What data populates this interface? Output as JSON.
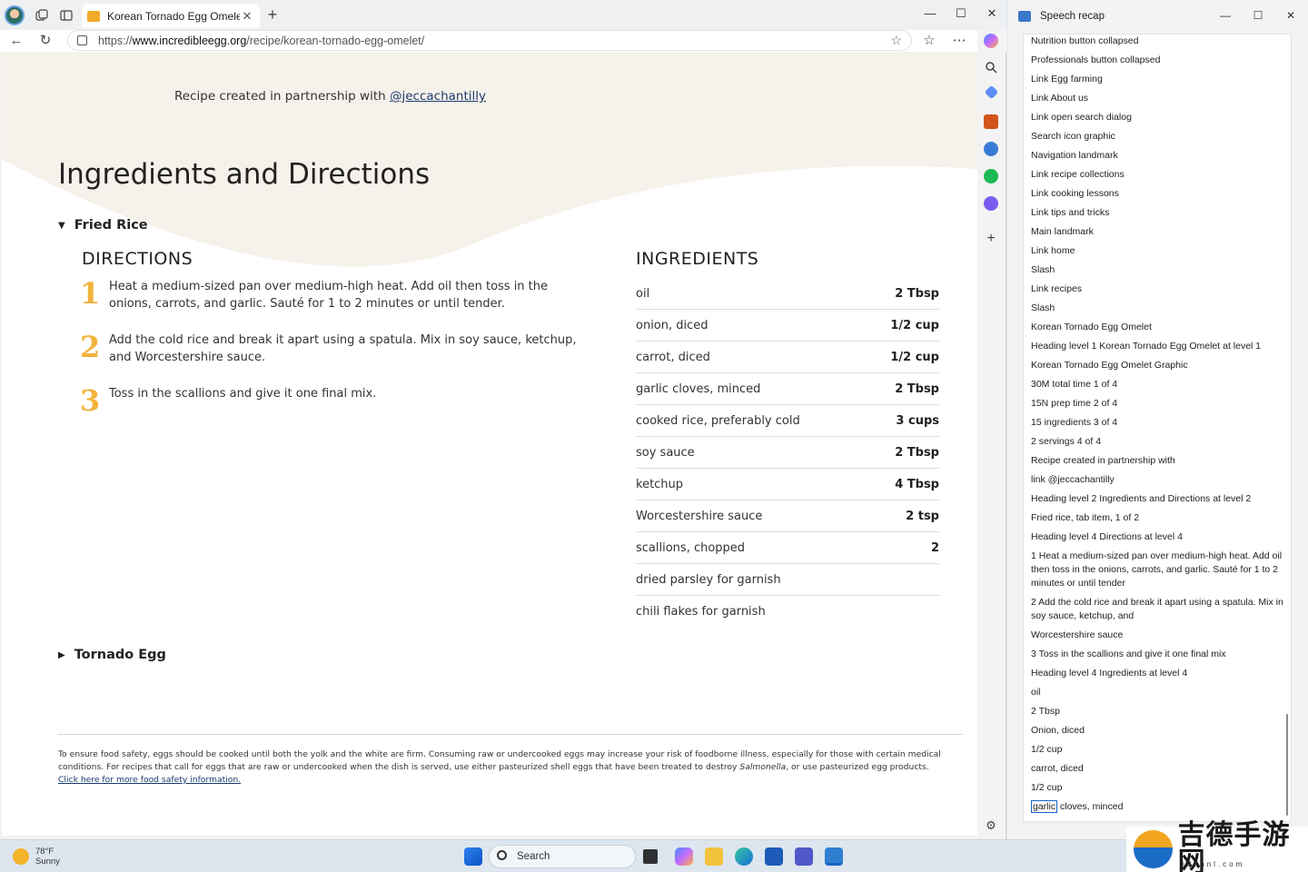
{
  "browser": {
    "tab_title": "Korean Tornado Egg Omelet - A",
    "url_prefix": "https://",
    "url_domain": "www.incredibleegg.org",
    "url_path": "/recipe/korean-tornado-egg-omelet/"
  },
  "page": {
    "partner_text": "Recipe created in partnership with ",
    "partner_link": "@jeccachantilly",
    "heading": "Ingredients and Directions",
    "tab1": "Fried Rice",
    "tab2": "Tornado Egg",
    "directions_heading": "DIRECTIONS",
    "ingredients_heading": "INGREDIENTS",
    "steps": [
      {
        "num": "1",
        "text": "Heat a medium-sized pan over medium-high heat. Add oil then toss in the onions, carrots, and garlic. Sauté for 1 to 2 minutes or until tender."
      },
      {
        "num": "2",
        "text": "Add the cold rice and break it apart using a spatula. Mix in soy sauce, ketchup, and Worcestershire sauce."
      },
      {
        "num": "3",
        "text": "Toss in the scallions and give it one final mix."
      }
    ],
    "ingredients": [
      {
        "name": "oil",
        "amount": "2 Tbsp"
      },
      {
        "name": "onion, diced",
        "amount": "1/2 cup"
      },
      {
        "name": "carrot, diced",
        "amount": "1/2 cup"
      },
      {
        "name": "garlic cloves, minced",
        "amount": "2 Tbsp"
      },
      {
        "name": "cooked rice, preferably cold",
        "amount": "3 cups"
      },
      {
        "name": "soy sauce",
        "amount": "2 Tbsp"
      },
      {
        "name": "ketchup",
        "amount": "4 Tbsp"
      },
      {
        "name": "Worcestershire sauce",
        "amount": "2 tsp"
      },
      {
        "name": "scallions, chopped",
        "amount": "2"
      },
      {
        "name": "dried parsley for garnish",
        "amount": ""
      },
      {
        "name": "chili flakes for garnish",
        "amount": ""
      }
    ],
    "safety_text_1": "To ensure food safety, eggs should be cooked until both the yolk and the white are firm. Consuming raw or undercooked eggs may increase your risk of foodborne illness, especially for those with certain medical conditions. For recipes that call for eggs that are raw or undercooked when the dish is served, use either pasteurized shell eggs that have been treated to destroy ",
    "safety_italic": "Salmonella",
    "safety_text_2": ", or use pasteurized egg products.",
    "safety_link": "Click here for more food safety information."
  },
  "recap": {
    "title": "Speech recap",
    "items": [
      "Nutrition button collapsed",
      "Professionals button collapsed",
      "Link Egg farming",
      "Link About us",
      "Link open search dialog",
      "Search icon graphic",
      "Navigation landmark",
      "Link recipe collections",
      "Link cooking lessons",
      "Link tips and tricks",
      "Main landmark",
      "Link home",
      "Slash",
      "Link recipes",
      "Slash",
      "Korean Tornado Egg Omelet",
      "Heading level 1 Korean Tornado Egg Omelet at level 1",
      "Korean Tornado Egg Omelet Graphic",
      "30M total time 1 of 4",
      "15N prep time 2 of 4",
      "15 ingredients 3 of 4",
      "2 servings 4 of 4",
      "Recipe created in partnership with",
      "link @jeccachantilly",
      "Heading level 2 Ingredients and Directions at level 2",
      "Fried rice, tab item, 1 of 2",
      "Heading level 4 Directions at level 4",
      "1 Heat a medium-sized pan over medium-high heat. Add oil then toss in the onions, carrots, and garlic. Sauté for 1 to 2 minutes or until tender",
      "2 Add the cold rice and break it apart using a spatula. Mix in soy sauce, ketchup, and",
      "Worcestershire sauce",
      "3 Toss in the scallions and give it one final mix",
      "Heading level 4 Ingredients at level 4",
      "oil",
      "2 Tbsp",
      "Onion, diced",
      "1/2 cup",
      "carrot, diced",
      "1/2 cup"
    ],
    "last_focus": "garlic",
    "last_rest": " cloves, minced"
  },
  "taskbar": {
    "temp": "78°F",
    "condition": "Sunny",
    "search_placeholder": "Search"
  },
  "watermark": {
    "text": "吉德手游网",
    "sub": "jdzhnl.com"
  },
  "colors": {
    "accent_number": "#f2b33d",
    "link": "#1a3a6d",
    "focus": "#1a62c8"
  }
}
